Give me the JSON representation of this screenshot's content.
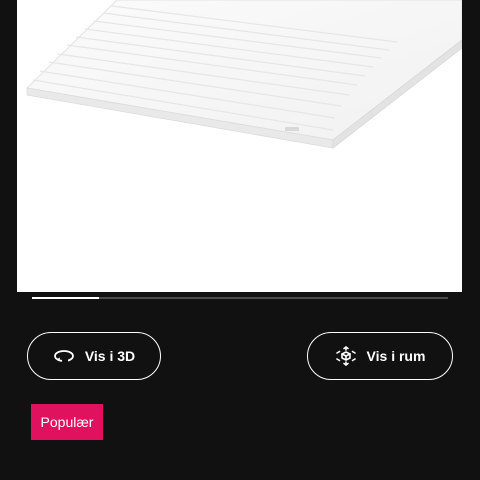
{
  "product": {
    "image_alt": "White mattress topper"
  },
  "carousel": {
    "progress": 0.16
  },
  "actions": {
    "view_3d_label": "Vis i 3D",
    "view_3d_icon": "rotate-360-icon",
    "view_room_label": "Vis i rum",
    "view_room_icon": "ar-cube-icon"
  },
  "badge": {
    "label": "Populær",
    "color": "#e0115f"
  },
  "colors": {
    "background": "#111111",
    "image_background": "#ffffff",
    "text": "#ffffff"
  }
}
